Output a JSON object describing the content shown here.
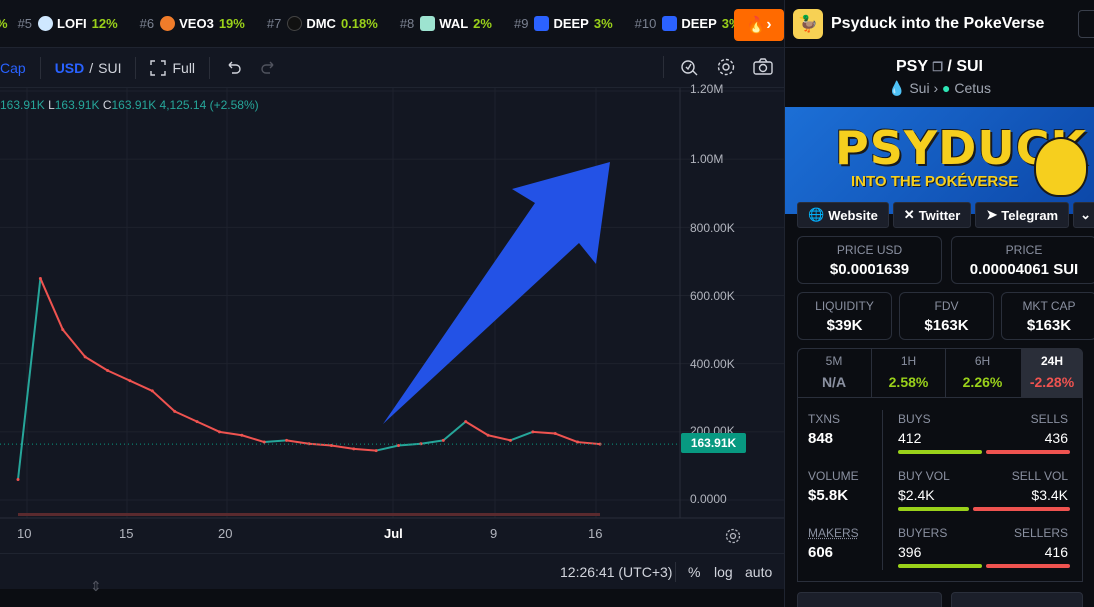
{
  "ticker": [
    {
      "rank": "#5",
      "symbol": "LOFI",
      "change": "12%",
      "icon_color": "#cfe8ff"
    },
    {
      "rank": "#6",
      "symbol": "VEO3",
      "change": "19%",
      "icon_color": "#f07c2a"
    },
    {
      "rank": "#7",
      "symbol": "DMC",
      "change": "0.18%",
      "icon_color": "#111111"
    },
    {
      "rank": "#8",
      "symbol": "WAL",
      "change": "2%",
      "icon_color": "#9de3d0"
    },
    {
      "rank": "#9",
      "symbol": "DEEP",
      "change": "3%",
      "icon_color": "#2b62ff"
    },
    {
      "rank": "#10",
      "symbol": "DEEP",
      "change": "3%",
      "icon_color": "#2b62ff"
    }
  ],
  "toolbar": {
    "mcap": "Cap",
    "currency_usd": "USD",
    "currency_sep": "/",
    "currency_sui": "SUI",
    "full": "Full"
  },
  "ohlc": {
    "o_val": "163.91K",
    "l_key": "L",
    "l_val": "163.91K",
    "c_key": "C",
    "c_val": "163.91K",
    "change": "4,125.14 (+2.58%)"
  },
  "y_axis": [
    "1.20M",
    "1.00M",
    "800.00K",
    "600.00K",
    "400.00K",
    "200.00K",
    "0.0000"
  ],
  "x_axis": [
    "10",
    "15",
    "20",
    "Jul",
    "9",
    "16"
  ],
  "current_price_label": "163.91K",
  "chart_data": {
    "type": "line",
    "series": [
      {
        "name": "",
        "x": [
          "Jun 10",
          "Jun 11",
          "Jun 12",
          "Jun 13",
          "Jun 14",
          "Jun 15",
          "Jun 16",
          "Jun 17",
          "Jun 18",
          "Jun 19",
          "Jun 20",
          "Jun 22",
          "Jun 24",
          "Jun 26",
          "Jun 28",
          "Jun 30",
          "Jul 2",
          "Jul 4",
          "Jul 6",
          "Jul 8",
          "Jul 10",
          "Jul 11",
          "Jul 12",
          "Jul 13",
          "Jul 14",
          "Jul 15",
          "Jul 16"
        ],
        "values": [
          60000,
          650000,
          500000,
          420000,
          380000,
          350000,
          320000,
          260000,
          230000,
          200000,
          190000,
          170000,
          175000,
          165000,
          160000,
          150000,
          145000,
          160000,
          165000,
          175000,
          230000,
          190000,
          175000,
          200000,
          195000,
          170000,
          163910
        ]
      }
    ],
    "ylim": [
      0,
      1200000
    ],
    "xlabel": "",
    "ylabel": ""
  },
  "bottom": {
    "time": "12:26:41 (UTC+3)",
    "pct": "%",
    "log": "log",
    "auto": "auto"
  },
  "panel": {
    "title": "Psyduck into the PokeVerse",
    "base": "PSY",
    "sep": "/",
    "quote": "SUI",
    "chain": "Sui",
    "dex": "Cetus",
    "banner_line1": "PSYDUCK",
    "banner_line2": "INTO THE POKÉVERSE",
    "links": {
      "website": "Website",
      "twitter": "Twitter",
      "telegram": "Telegram"
    },
    "price_usd_label": "PRICE USD",
    "price_usd": "$0.0001639",
    "price_label": "PRICE",
    "price": "0.00004061 SUI",
    "liquidity_label": "LIQUIDITY",
    "liquidity": "$39K",
    "fdv_label": "FDV",
    "fdv": "$163K",
    "mktcap_label": "MKT CAP",
    "mktcap": "$163K",
    "timeframes": [
      {
        "label": "5M",
        "value": "N/A",
        "color": "#8a90a0"
      },
      {
        "label": "1H",
        "value": "2.58%",
        "color": "#9ad11a"
      },
      {
        "label": "6H",
        "value": "2.26%",
        "color": "#9ad11a"
      },
      {
        "label": "24H",
        "value": "-2.28%",
        "color": "#ef5350"
      }
    ],
    "txns_label": "TXNS",
    "txns": "848",
    "buys_label": "BUYS",
    "buys": "412",
    "sells_label": "SELLS",
    "sells": "436",
    "volume_label": "VOLUME",
    "volume": "$5.8K",
    "buyvol_label": "BUY VOL",
    "buyvol": "$2.4K",
    "sellvol_label": "SELL VOL",
    "sellvol": "$3.4K",
    "makers_label": "MAKERS",
    "makers": "606",
    "buyers_label": "BUYERS",
    "buyers": "396",
    "sellers_label": "SELLERS",
    "sellers": "416",
    "buy_share": 0.486,
    "buyvol_share": 0.41,
    "buyers_share": 0.488
  }
}
